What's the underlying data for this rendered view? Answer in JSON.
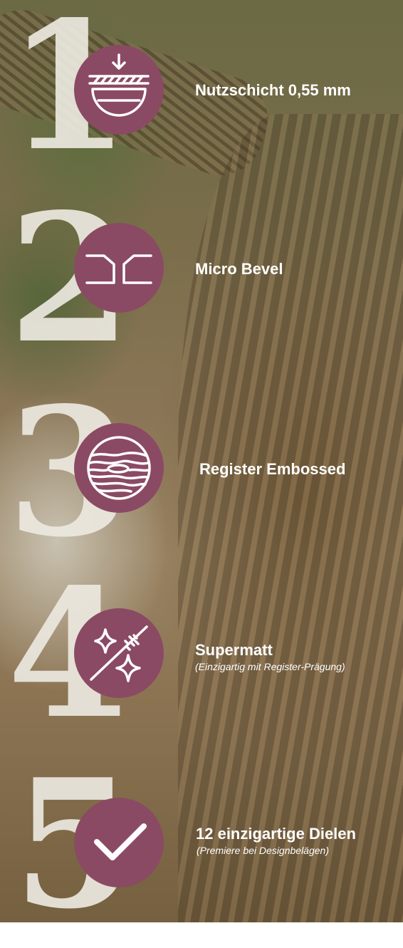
{
  "colors": {
    "badge": "#8b4a63",
    "numeral": "#ece8e0",
    "text": "#ffffff"
  },
  "features": [
    {
      "number": "1",
      "icon": "wear-layer-icon",
      "title": "Nutzschicht 0,55 mm",
      "subtitle": ""
    },
    {
      "number": "2",
      "icon": "micro-bevel-icon",
      "title": "Micro Bevel",
      "subtitle": ""
    },
    {
      "number": "3",
      "icon": "wood-grain-icon",
      "title": "Register Embossed",
      "subtitle": ""
    },
    {
      "number": "4",
      "icon": "sparkle-matte-icon",
      "title": "Supermatt",
      "subtitle": "(Einzigartig mit Register-Prägung)"
    },
    {
      "number": "5",
      "icon": "checkmark-icon",
      "title": "12 einzigartige Dielen",
      "subtitle": "(Premiere bei Designbelägen)"
    }
  ]
}
